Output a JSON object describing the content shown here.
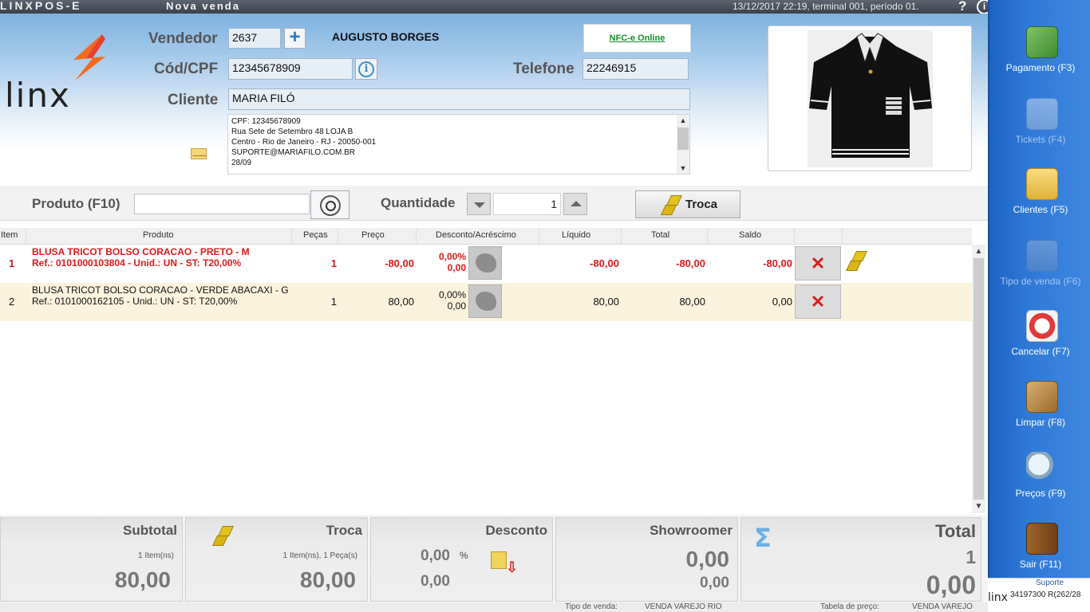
{
  "titlebar": {
    "app": "LINXPOS-E",
    "screen": "Nova venda",
    "status": "13/12/2017 22:19, terminal 001, período 01.",
    "help": "?",
    "info": "i"
  },
  "header": {
    "logo_text": "linx",
    "vendedor_label": "Vendedor",
    "vendedor_value": "2637",
    "vendedor_add": "+",
    "vendedor_name": "AUGUSTO BORGES",
    "nfce_label": "NFC-e Online",
    "cpf_label": "Cód/CPF",
    "cpf_value": "12345678909",
    "cpf_info": "i",
    "telefone_label": "Telefone",
    "telefone_value": "22246915",
    "cliente_label": "Cliente",
    "cliente_value": "MARIA FILÓ",
    "address_lines": [
      "CPF: 12345678909",
      "Rua Sete de Setembro 48 LOJA B",
      "Centro - Rio de Janeiro - RJ - 20050-001",
      "SUPORTE@MARIAFILO.COM.BR",
      "28/09"
    ]
  },
  "entry": {
    "produto_label": "Produto (F10)",
    "produto_value": "",
    "quantidade_label": "Quantidade",
    "quantidade_value": "1",
    "troca_label": "Troca"
  },
  "table": {
    "columns": [
      "Item",
      "Produto",
      "Peças",
      "Preço",
      "Desconto/Acréscimo",
      "Líquido",
      "Total",
      "Saldo"
    ],
    "rows": [
      {
        "item": "1",
        "name": "BLUSA TRICOT BOLSO CORACAO - PRETO - M",
        "ref": "Ref.: 0101000103804 - Unid.: UN - ST: T20,00%",
        "pecas": "1",
        "preco": "-80,00",
        "desc_pct": "0,00%",
        "desc_val": "0,00",
        "liquido": "-80,00",
        "total": "-80,00",
        "saldo": "-80,00",
        "exchange": true
      },
      {
        "item": "2",
        "name": "BLUSA TRICOT BOLSO CORACAO - VERDE ABACAXI - G",
        "ref": "Ref.: 0101000162105 - Unid.: UN - ST: T20,00%",
        "pecas": "1",
        "preco": "80,00",
        "desc_pct": "0,00%",
        "desc_val": "0,00",
        "liquido": "80,00",
        "total": "80,00",
        "saldo": "0,00",
        "exchange": false
      }
    ]
  },
  "totals": {
    "subtotal": {
      "title": "Subtotal",
      "count": "1 Item(ns)",
      "value": "80,00"
    },
    "troca": {
      "title": "Troca",
      "count": "1 Item(ns), 1 Peça(s)",
      "value": "80,00"
    },
    "desconto": {
      "title": "Desconto",
      "pct": "0,00",
      "pct_sign": "%",
      "value": "0,00"
    },
    "showroomer": {
      "title": "Showroomer",
      "value1": "0,00",
      "value2": "0,00"
    },
    "total": {
      "title": "Total",
      "count": "1",
      "value": "0,00"
    }
  },
  "statusbar": {
    "tipo_label": "Tipo de venda:",
    "tipo_value": "VENDA VAREJO RIO",
    "tabela_label": "Tabela de preço:",
    "tabela_value": "VENDA VAREJO"
  },
  "sidebar": {
    "items": [
      {
        "label": "Pagamento (F3)",
        "icon": "money-icon",
        "enabled": true
      },
      {
        "label": "Tickets (F4)",
        "icon": "tickets-icon",
        "enabled": false
      },
      {
        "label": "Clientes (F5)",
        "icon": "clients-folder-icon",
        "enabled": true
      },
      {
        "label": "Tipo de venda (F6)",
        "icon": "shopping-bag-icon",
        "enabled": false
      },
      {
        "label": "Cancelar (F7)",
        "icon": "cancel-icon",
        "enabled": true
      },
      {
        "label": "Limpar (F8)",
        "icon": "broom-icon",
        "enabled": true
      },
      {
        "label": "Preços (F9)",
        "icon": "price-search-icon",
        "enabled": true
      },
      {
        "label": "Sair (F11)",
        "icon": "exit-door-icon",
        "enabled": true
      }
    ],
    "support_label": "Suporte",
    "support_number": "34197300 R(262/28",
    "support_logo": "linx"
  },
  "colors": {
    "accent_blue": "#2f7ad8",
    "negative_red": "#e01818",
    "nfce_green": "#138f2a",
    "exchange_row": "#fcf3dc"
  }
}
